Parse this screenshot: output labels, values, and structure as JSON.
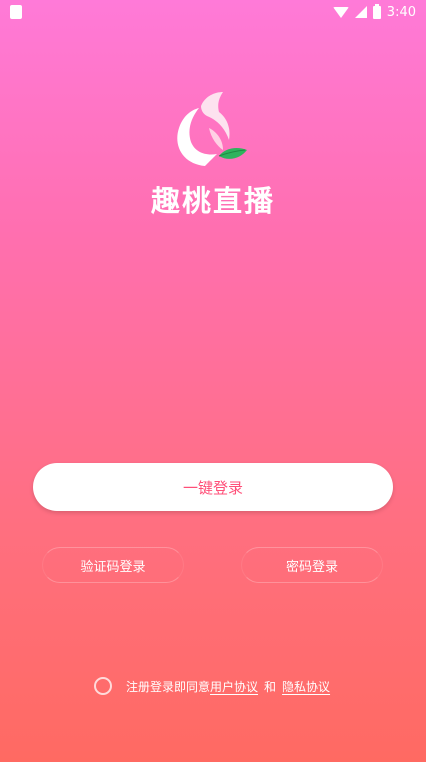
{
  "status_bar": {
    "time": "3:40",
    "icons": [
      "sim-card-icon",
      "wifi-icon",
      "signal-icon",
      "battery-icon"
    ]
  },
  "app": {
    "name": "趣桃直播",
    "logo_icon": "peach-logo-icon"
  },
  "login": {
    "one_key_label": "一键登录",
    "sms_label": "验证码登录",
    "password_label": "密码登录"
  },
  "agreement": {
    "prefix": "注册登录即同意",
    "user_agreement": "用户协议",
    "and": "和",
    "privacy_policy": "隐私协议"
  },
  "colors": {
    "gradient_top": "#ff7ad8",
    "gradient_bottom": "#ff6a62",
    "button_text": "#ff4f78"
  }
}
